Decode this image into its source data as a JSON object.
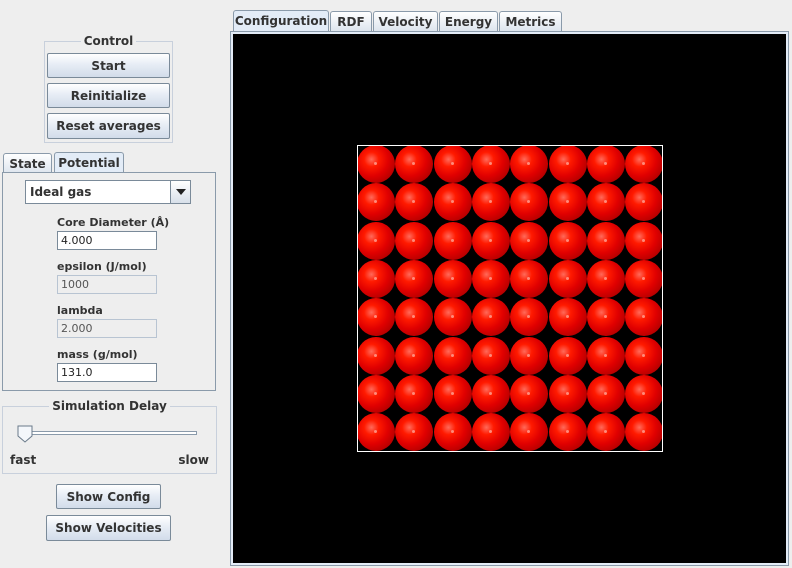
{
  "control": {
    "title": "Control",
    "start_label": "Start",
    "reinitialize_label": "Reinitialize",
    "reset_label": "Reset averages"
  },
  "left_tabs": [
    {
      "label": "State",
      "active": false
    },
    {
      "label": "Potential",
      "active": true
    }
  ],
  "potential": {
    "selected": "Ideal gas",
    "fields": [
      {
        "label": "Core Diameter (Å)",
        "value": "4.000",
        "editable": true
      },
      {
        "label": "epsilon (J/mol)",
        "value": "1000",
        "editable": false
      },
      {
        "label": "lambda",
        "value": "2.000",
        "editable": false
      },
      {
        "label": "mass (g/mol)",
        "value": "131.0",
        "editable": true
      }
    ]
  },
  "delay": {
    "title": "Simulation Delay",
    "min_label": "fast",
    "max_label": "slow",
    "value": 0
  },
  "buttons": {
    "show_config": "Show Config",
    "show_velocities": "Show Velocities"
  },
  "right_tabs": [
    {
      "label": "Configuration",
      "active": true
    },
    {
      "label": "RDF",
      "active": false
    },
    {
      "label": "Velocity",
      "active": false
    },
    {
      "label": "Energy",
      "active": false
    },
    {
      "label": "Metrics",
      "active": false
    }
  ],
  "simulation": {
    "lattice_rows": 8,
    "lattice_cols": 8,
    "atom_color": "#e00000",
    "background_color": "#000000",
    "box_color": "#ffffff"
  }
}
